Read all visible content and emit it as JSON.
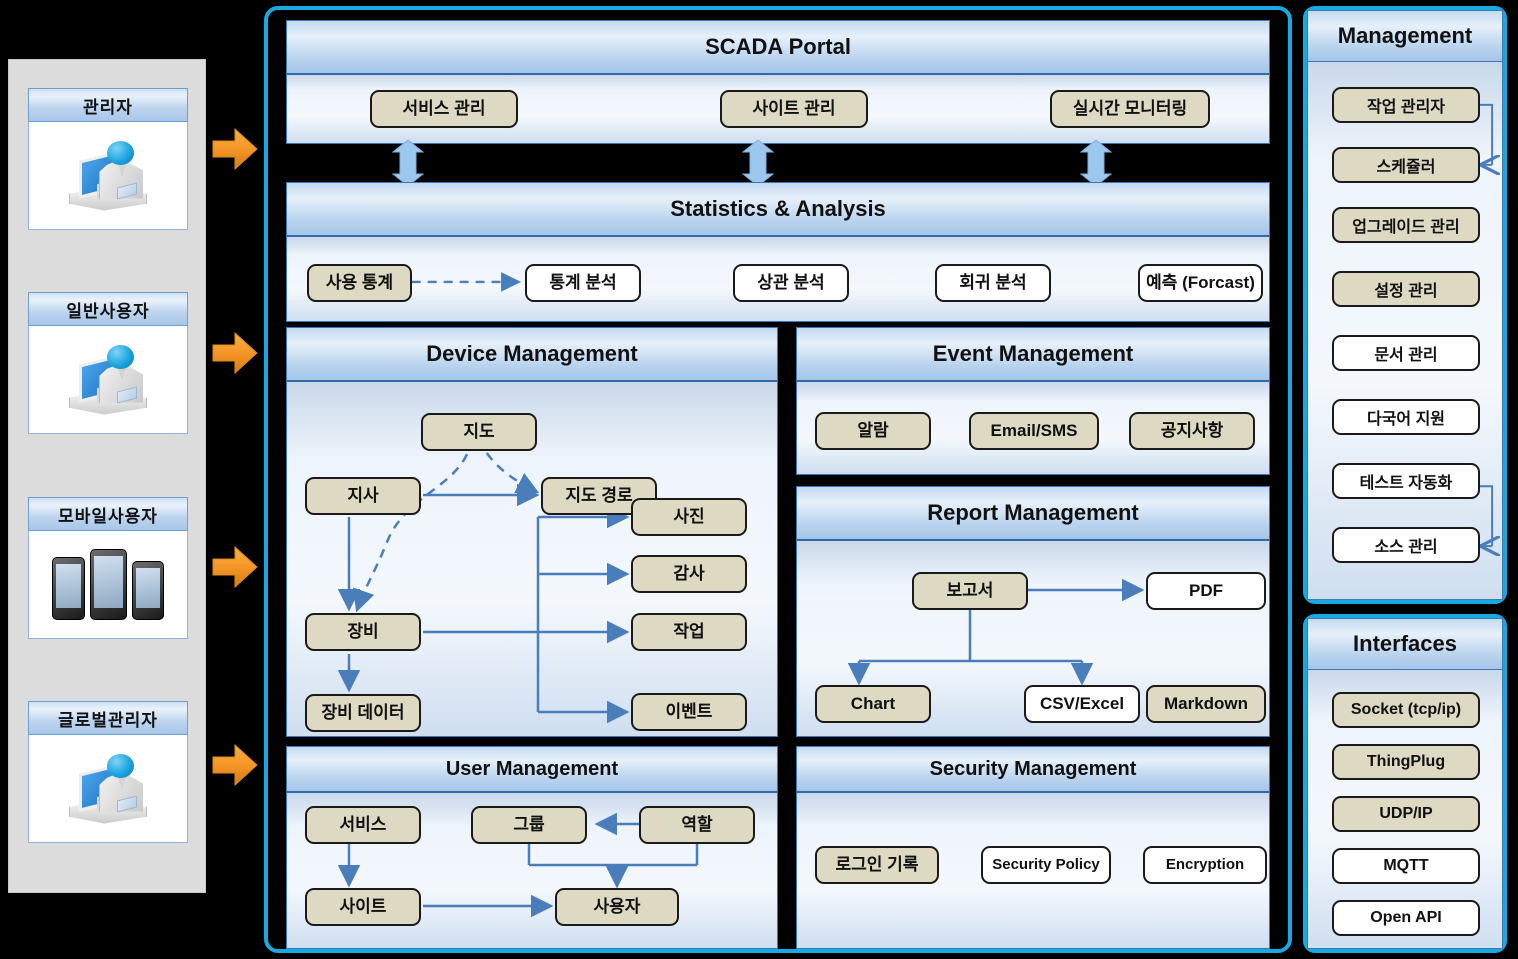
{
  "actors": {
    "items": [
      {
        "label": "관리자",
        "icon": "desk-person-icon"
      },
      {
        "label": "일반사용자",
        "icon": "desk-person-icon"
      },
      {
        "label": "모바일사용자",
        "icon": "mobile-phones-icon"
      },
      {
        "label": "글로벌관리자",
        "icon": "desk-person-icon"
      }
    ]
  },
  "scada_portal": {
    "title": "SCADA Portal",
    "nodes": [
      {
        "label": "서비스 관리",
        "style": "tan"
      },
      {
        "label": "사이트 관리",
        "style": "tan"
      },
      {
        "label": "실시간 모니터링",
        "style": "tan"
      }
    ]
  },
  "statistics": {
    "title": "Statistics & Analysis",
    "nodes": [
      {
        "label": "사용 통계",
        "style": "tan"
      },
      {
        "label": "통계 분석",
        "style": "white"
      },
      {
        "label": "상관 분석",
        "style": "white"
      },
      {
        "label": "회귀 분석",
        "style": "white"
      },
      {
        "label": "예측 (Forcast)",
        "style": "white"
      }
    ]
  },
  "device_management": {
    "title": "Device Management",
    "nodes": [
      {
        "label": "지도",
        "style": "tan"
      },
      {
        "label": "지사",
        "style": "tan"
      },
      {
        "label": "지도 경로",
        "style": "tan"
      },
      {
        "label": "장비",
        "style": "tan"
      },
      {
        "label": "장비 데이터",
        "style": "tan"
      },
      {
        "label": "사진",
        "style": "tan"
      },
      {
        "label": "감사",
        "style": "tan"
      },
      {
        "label": "작업",
        "style": "tan"
      },
      {
        "label": "이벤트",
        "style": "tan"
      }
    ]
  },
  "event_management": {
    "title": "Event Management",
    "nodes": [
      {
        "label": "알람",
        "style": "tan"
      },
      {
        "label": "Email/SMS",
        "style": "tan"
      },
      {
        "label": "공지사항",
        "style": "tan"
      }
    ]
  },
  "report_management": {
    "title": "Report Management",
    "nodes": [
      {
        "label": "보고서",
        "style": "tan"
      },
      {
        "label": "PDF",
        "style": "white"
      },
      {
        "label": "Chart",
        "style": "tan"
      },
      {
        "label": "CSV/Excel",
        "style": "white"
      },
      {
        "label": "Markdown",
        "style": "tan"
      }
    ]
  },
  "user_management": {
    "title": "User Management",
    "nodes": [
      {
        "label": "서비스",
        "style": "tan"
      },
      {
        "label": "그룹",
        "style": "tan"
      },
      {
        "label": "역할",
        "style": "tan"
      },
      {
        "label": "사이트",
        "style": "tan"
      },
      {
        "label": "사용자",
        "style": "tan"
      }
    ]
  },
  "security_management": {
    "title": "Security Management",
    "nodes": [
      {
        "label": "로그인 기록",
        "style": "tan"
      },
      {
        "label": "Security Policy",
        "style": "white"
      },
      {
        "label": "Encryption",
        "style": "white"
      }
    ]
  },
  "management": {
    "title": "Management",
    "items": [
      {
        "label": "작업 관리자",
        "style": "tan"
      },
      {
        "label": "스케쥴러",
        "style": "tan"
      },
      {
        "label": "업그레이드 관리",
        "style": "tan"
      },
      {
        "label": "설정 관리",
        "style": "tan"
      },
      {
        "label": "문서 관리",
        "style": "white"
      },
      {
        "label": "다국어 지원",
        "style": "white"
      },
      {
        "label": "테스트 자동화",
        "style": "white"
      },
      {
        "label": "소스 관리",
        "style": "white"
      }
    ]
  },
  "interfaces": {
    "title": "Interfaces",
    "items": [
      {
        "label": "Socket (tcp/ip)",
        "style": "tan"
      },
      {
        "label": "ThingPlug",
        "style": "tan"
      },
      {
        "label": "UDP/IP",
        "style": "tan"
      },
      {
        "label": "MQTT",
        "style": "white"
      },
      {
        "label": "Open API",
        "style": "white"
      }
    ]
  },
  "colors": {
    "panel_border": "#17a9e0",
    "node_fill_tan": "#ddd9c3",
    "node_fill_white": "#ffffff",
    "header_blue": "#b9d3ee",
    "connector_blue": "#4a7ebb",
    "actor_arrow_orange": "#f39325",
    "background": "#000000"
  }
}
